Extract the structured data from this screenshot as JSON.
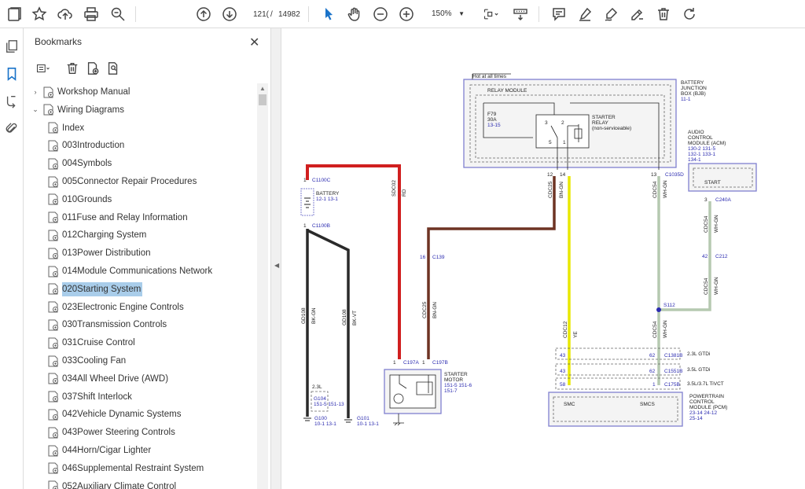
{
  "toolbar": {
    "page_current": "121(",
    "page_separator": "/",
    "page_total": "14982",
    "zoom": "150%",
    "icons": [
      "sidebar-icon",
      "bookmark-star-icon",
      "upload-cloud-icon",
      "print-icon",
      "zoom-search-icon",
      "prev-page-icon",
      "next-page-icon",
      "select-cursor-icon",
      "hand-tool-icon",
      "zoom-out-icon",
      "zoom-in-icon",
      "fit-page-icon",
      "scroll-mode-icon",
      "comment-icon",
      "highlight-icon",
      "draw-icon",
      "edit-sign-icon",
      "delete-icon",
      "rotate-icon"
    ]
  },
  "rail": {
    "icons": [
      "pages-icon",
      "bookmarks-icon",
      "layers-icon",
      "attachments-icon"
    ]
  },
  "bookmarks": {
    "title": "Bookmarks",
    "close": "✕",
    "items": [
      {
        "label": "Workshop Manual",
        "level": 0,
        "expand": "›",
        "selected": false
      },
      {
        "label": "Wiring Diagrams",
        "level": 0,
        "expand": "⌄",
        "selected": false
      },
      {
        "label": "Index",
        "level": 1,
        "selected": false
      },
      {
        "label": "003Introduction",
        "level": 1,
        "selected": false
      },
      {
        "label": "004Symbols",
        "level": 1,
        "selected": false
      },
      {
        "label": "005Connector Repair Procedures",
        "level": 1,
        "selected": false
      },
      {
        "label": "010Grounds",
        "level": 1,
        "selected": false
      },
      {
        "label": "011Fuse and Relay Information",
        "level": 1,
        "selected": false
      },
      {
        "label": "012Charging System",
        "level": 1,
        "selected": false
      },
      {
        "label": "013Power Distribution",
        "level": 1,
        "selected": false
      },
      {
        "label": "014Module Communications Network",
        "level": 1,
        "selected": false
      },
      {
        "label": "020Starting System",
        "level": 1,
        "selected": true
      },
      {
        "label": "023Electronic Engine Controls",
        "level": 1,
        "selected": false
      },
      {
        "label": "030Transmission Controls",
        "level": 1,
        "selected": false
      },
      {
        "label": "031Cruise Control",
        "level": 1,
        "selected": false
      },
      {
        "label": "033Cooling Fan",
        "level": 1,
        "selected": false
      },
      {
        "label": "034All Wheel Drive (AWD)",
        "level": 1,
        "selected": false
      },
      {
        "label": "037Shift Interlock",
        "level": 1,
        "selected": false
      },
      {
        "label": "042Vehicle Dynamic Systems",
        "level": 1,
        "selected": false
      },
      {
        "label": "043Power Steering Controls",
        "level": 1,
        "selected": false
      },
      {
        "label": "044Horn/Cigar Lighter",
        "level": 1,
        "selected": false
      },
      {
        "label": "046Supplemental Restraint System",
        "level": 1,
        "selected": false
      },
      {
        "label": "052Auxiliary Climate Control",
        "level": 1,
        "selected": false
      }
    ]
  },
  "colors": {
    "accent": "#1a73c9",
    "selection": "#a9cdea",
    "wire_red": "#d01f1f",
    "wire_brown": "#6e3324",
    "wire_yellow": "#e8e800",
    "wire_green": "#b5c9b0",
    "wire_black": "#2a2a2a",
    "module_border": "#8080d0",
    "ref_blue": "#2b2bb0"
  },
  "diagram": {
    "hot_label": "Hot at all times",
    "relay_module": "RELAY MODULE",
    "bjb_1": "BATTERY",
    "bjb_2": "JUNCTION",
    "bjb_3": "BOX (BJB)",
    "bjb_ref": "11-1",
    "fuse_name": "F79",
    "fuse_amps": "30A",
    "fuse_ref": "13-15",
    "relay_name": "STARTER",
    "relay_name2": "RELAY",
    "relay_note": "(non-serviceable)",
    "relay_pins": [
      "3",
      "2",
      "5",
      "1"
    ],
    "acm_1": "AUDIO",
    "acm_2": "CONTROL",
    "acm_3": "MODULE (ACM)",
    "acm_ref1": "130-2 131-5",
    "acm_ref2": "132-1 133-1",
    "acm_ref3": "134-1",
    "acm_start": "START",
    "c1100c": "C1100C",
    "c1100c_pin": "1",
    "battery": "BATTERY",
    "battery_ref": "12-1  13-1",
    "c1100b": "C1100B",
    "c1100b_pin": "1",
    "sdc02": "SDC02",
    "rd": "RD",
    "gd108a": "GD108",
    "bkgn": "BK-GN",
    "gd108b": "GD108",
    "bkvt": "BK-VT",
    "c139": "C139",
    "c139_pin": "16",
    "cdc25a": "CDC25",
    "bngn_a": "BN-GN",
    "cdc25b": "CDC25",
    "bngn_b": "BN-GN",
    "pin12": "12",
    "pin14": "14",
    "pin13": "13",
    "c1035d": "C1035D",
    "cdc54a": "CDC54",
    "whgn_a": "WH-GN",
    "c240a_pin": "3",
    "c240a": "C240A",
    "cdc54b": "CDC54",
    "whgn_b": "WH-GN",
    "c212_pin": "42",
    "c212": "C212",
    "cdc54c": "CDC54",
    "whgn_c": "WH-GN",
    "s112": "S112",
    "cdc12": "CDC12",
    "ye": "YE",
    "cdc54d": "CDC54",
    "whgn_d": "WH-GN",
    "c197a_pin": "1",
    "c197a": "C197A",
    "c197b_pin": "1",
    "c197b": "C197B",
    "starter_1": "STARTER",
    "starter_2": "MOTOR",
    "starter_ref1": "151-5  151-6",
    "starter_ref2": "151-7",
    "g104_var": "2.3L",
    "g104": "G104",
    "g104_ref": "151-5  151-13",
    "g100": "G100",
    "g100_ref": "10-1   13-1",
    "g101": "G101",
    "g101_ref": "10-1   13-1",
    "c1381b_l": "43",
    "c1381b_r": "62",
    "c1381b": "C1381B",
    "var1": "2.3L GTDi",
    "c1551b_l": "43",
    "c1551b_r": "62",
    "c1551b": "C1551B",
    "var2": "3.5L GTDi",
    "c175b_l": "58",
    "c175b_r": "1",
    "c175b": "C175B",
    "var3": "3.5L/3.7L TiVCT",
    "pcm_smc": "SMC",
    "pcm_smcs": "SMCS",
    "pcm_1": "POWERTRAIN",
    "pcm_2": "CONTROL",
    "pcm_3": "MODULE (PCM)",
    "pcm_ref1": "23-14  24-12",
    "pcm_ref2": "25-14"
  }
}
